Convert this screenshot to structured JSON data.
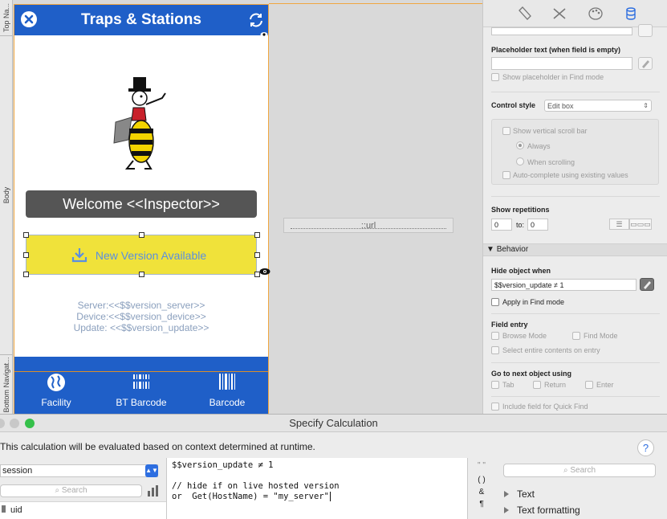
{
  "parts": {
    "top": "Top Na...",
    "body": "Body",
    "bottom": "Bottom Navigat..."
  },
  "layout": {
    "title": "Traps & Stations",
    "welcome": "Welcome <<Inspector>>",
    "update_button": "New Version Available",
    "server_line": "Server:<<$$version_server>>",
    "device_line": "Device:<<$$version_device>>",
    "update_line": "Update: <<$$version_update>>",
    "nav": [
      {
        "label": "Facility",
        "icon": "globe-icon"
      },
      {
        "label": "BT Barcode",
        "icon": "barcode-icon"
      },
      {
        "label": "Barcode",
        "icon": "barcode-icon"
      }
    ],
    "url_field": "::url"
  },
  "inspector": {
    "tabs": [
      "position-tab",
      "appearance-tab",
      "style-tab",
      "data-tab"
    ],
    "placeholder_label": "Placeholder text (when field is empty)",
    "show_placeholder_find": "Show placeholder in Find mode",
    "control_style_label": "Control style",
    "control_style_value": "Edit box",
    "show_vscroll": "Show vertical scroll bar",
    "always": "Always",
    "when_scrolling": "When scrolling",
    "autocomplete": "Auto-complete using existing values",
    "show_repetitions_label": "Show repetitions",
    "rep_from": "0",
    "rep_to_label": "to:",
    "rep_to": "0",
    "behavior_label": "Behavior",
    "hide_object_label": "Hide object when",
    "hide_object_value": "$$version_update ≠ 1",
    "apply_find": "Apply in Find mode",
    "field_entry_label": "Field entry",
    "browse_mode": "Browse Mode",
    "find_mode": "Find Mode",
    "select_entire": "Select entire contents on entry",
    "go_next_label": "Go to next object using",
    "tab": "Tab",
    "return": "Return",
    "enter": "Enter",
    "quick_find": "Include field for Quick Find"
  },
  "dialog": {
    "title": "Specify Calculation",
    "description": "This calculation will be evaluated based on context determined at runtime.",
    "help": "?",
    "scope_value": "session",
    "left_search_placeholder": "Search",
    "left_first_item": "uid",
    "calc_lines": [
      "$$version_update ≠ 1",
      "",
      "// hide if on live hosted version",
      "or  Get(HostName) = \"my_server\""
    ],
    "operators": [
      "\" \"",
      "( )",
      "&",
      "¶"
    ],
    "right_search_placeholder": "Search",
    "functions": [
      "Text",
      "Text formatting"
    ]
  },
  "colors": {
    "header_blue": "#1f5fc8",
    "update_yellow": "#f0e23a",
    "welcome_gray": "#555555",
    "accent": "#2d6ee0"
  }
}
